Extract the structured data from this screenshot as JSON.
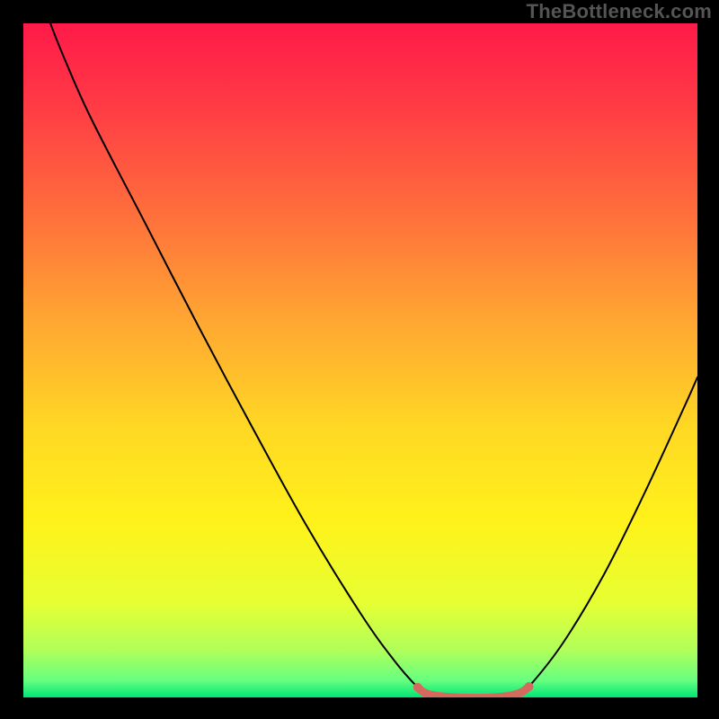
{
  "attribution": "TheBottleneck.com",
  "chart_data": {
    "type": "line",
    "title": "",
    "xlabel": "",
    "ylabel": "",
    "xlim": [
      0,
      100
    ],
    "ylim": [
      0,
      100
    ],
    "background_gradient": {
      "stops": [
        {
          "offset": 0.0,
          "color": "#ff1a49"
        },
        {
          "offset": 0.12,
          "color": "#ff3a45"
        },
        {
          "offset": 0.28,
          "color": "#ff6e3c"
        },
        {
          "offset": 0.44,
          "color": "#ffa632"
        },
        {
          "offset": 0.6,
          "color": "#ffd824"
        },
        {
          "offset": 0.74,
          "color": "#fff21a"
        },
        {
          "offset": 0.86,
          "color": "#e6ff33"
        },
        {
          "offset": 0.93,
          "color": "#b0ff5a"
        },
        {
          "offset": 0.975,
          "color": "#66ff80"
        },
        {
          "offset": 1.0,
          "color": "#00e676"
        }
      ]
    },
    "series": [
      {
        "name": "bottleneck-curve",
        "color": "#000000",
        "stroke_width": 2,
        "points": [
          {
            "x": 4.0,
            "y": 100.0
          },
          {
            "x": 6.0,
            "y": 95.0
          },
          {
            "x": 10.0,
            "y": 86.0
          },
          {
            "x": 18.0,
            "y": 70.5
          },
          {
            "x": 26.0,
            "y": 55.0
          },
          {
            "x": 34.0,
            "y": 40.0
          },
          {
            "x": 42.0,
            "y": 25.5
          },
          {
            "x": 50.0,
            "y": 12.5
          },
          {
            "x": 55.0,
            "y": 5.5
          },
          {
            "x": 58.5,
            "y": 1.5
          },
          {
            "x": 60.0,
            "y": 0.5
          },
          {
            "x": 64.0,
            "y": 0.0
          },
          {
            "x": 70.0,
            "y": 0.0
          },
          {
            "x": 73.5,
            "y": 0.6
          },
          {
            "x": 75.0,
            "y": 1.6
          },
          {
            "x": 80.0,
            "y": 8.0
          },
          {
            "x": 86.0,
            "y": 18.0
          },
          {
            "x": 92.0,
            "y": 30.0
          },
          {
            "x": 98.0,
            "y": 43.0
          },
          {
            "x": 100.0,
            "y": 47.5
          }
        ]
      }
    ],
    "optimal_band": {
      "color": "#d46a5e",
      "stroke_width": 9,
      "linecap": "round",
      "points": [
        {
          "x": 58.5,
          "y": 1.5
        },
        {
          "x": 60.0,
          "y": 0.5
        },
        {
          "x": 64.0,
          "y": 0.0
        },
        {
          "x": 70.0,
          "y": 0.0
        },
        {
          "x": 73.5,
          "y": 0.6
        },
        {
          "x": 75.0,
          "y": 1.6
        }
      ],
      "endpoint_radius": 5
    }
  }
}
